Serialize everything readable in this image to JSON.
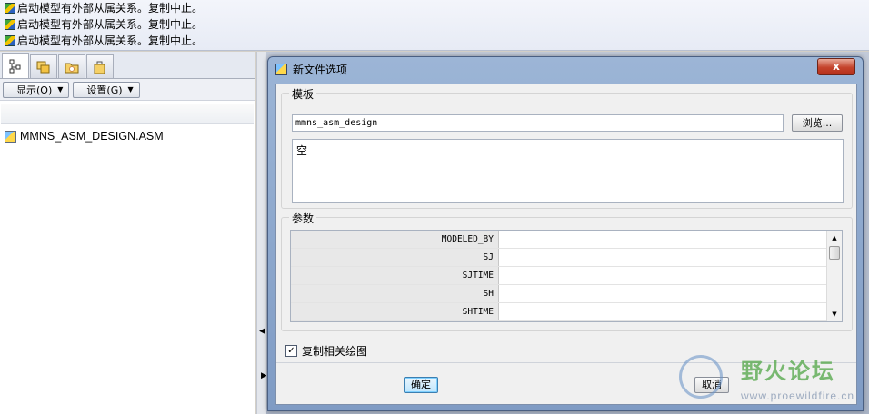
{
  "messages": [
    "启动模型有外部从属关系。复制中止。",
    "启动模型有外部从属关系。复制中止。",
    "启动模型有外部从属关系。复制中止。"
  ],
  "left_panel": {
    "tab_icons": [
      "model-tree-icon",
      "layers-icon",
      "folder-star-icon",
      "plugin-icon"
    ],
    "show_button": "显示(O)",
    "settings_button": "设置(G)",
    "tree_items": [
      {
        "label": "MMNS_ASM_DESIGN.ASM",
        "icon": "assembly-icon"
      }
    ]
  },
  "dialog": {
    "title": "新文件选项",
    "close_label": "x",
    "template_group": "模板",
    "template_value": "mmns_asm_design",
    "browse_button": "浏览...",
    "template_list": [
      "空"
    ],
    "params_group": "参数",
    "params": [
      {
        "name": "MODELED_BY",
        "value": ""
      },
      {
        "name": "SJ",
        "value": ""
      },
      {
        "name": "SJTIME",
        "value": ""
      },
      {
        "name": "SH",
        "value": ""
      },
      {
        "name": "SHTIME",
        "value": ""
      }
    ],
    "copy_drawing_checkbox": {
      "label": "复制相关绘图",
      "checked": true
    },
    "ok_button": "确定",
    "cancel_button": "取消"
  },
  "watermark": {
    "title": "野火论坛",
    "url": "www.proewildfire.cn"
  }
}
